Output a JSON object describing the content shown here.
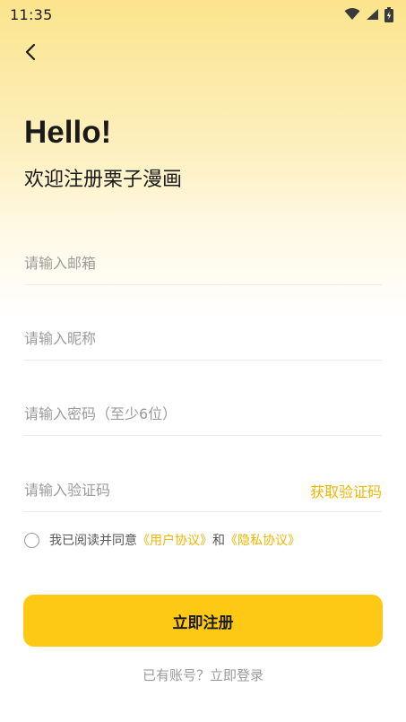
{
  "status_bar": {
    "time": "11:35",
    "icons": [
      "wifi-icon",
      "signal-icon",
      "battery-charging-icon"
    ]
  },
  "header": {
    "back_icon": "chevron-left-icon"
  },
  "hero": {
    "greeting": "Hello!",
    "subtitle": "欢迎注册栗子漫画"
  },
  "form": {
    "email_placeholder": "请输入邮箱",
    "nickname_placeholder": "请输入昵称",
    "password_placeholder": "请输入密码（至少6位）",
    "code_placeholder": "请输入验证码",
    "get_code_label": "获取验证码"
  },
  "agreement": {
    "prefix": "我已阅读并同意",
    "user_agreement": "《用户协议》",
    "and": "和",
    "privacy_agreement": "《隐私协议》",
    "checked": false
  },
  "actions": {
    "register_label": "立即注册",
    "login_prompt": "已有账号？立即登录"
  },
  "colors": {
    "accent": "#fdc914",
    "link": "#f0b400",
    "gradient_top": "#fbe48c"
  }
}
